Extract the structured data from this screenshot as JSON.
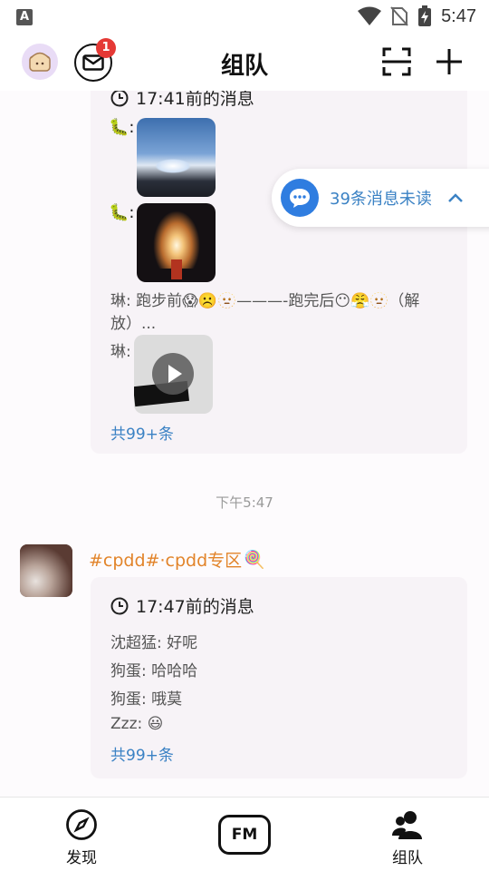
{
  "status_bar": {
    "time": "5:47",
    "app_badge": "A"
  },
  "header": {
    "title": "组队",
    "mail_badge": "1"
  },
  "card1": {
    "head_time": "17:41前的消息",
    "msg_text": "琳: 跑步前😱☹️🫥———-跑完后😶😤🫥（解放）...",
    "video_sender": "琳:",
    "more": "共99+条"
  },
  "unread": {
    "text": "39条消息未读"
  },
  "time_separator": "下午5:47",
  "group": {
    "name": "#cpdd#·cpdd专区",
    "emoji": "🍭"
  },
  "card2": {
    "head_time": "17:47前的消息",
    "messages": [
      "沈超猛: 好呢",
      "狗蛋: 哈哈哈",
      "狗蛋: 哦莫",
      "Zzz: 😃"
    ],
    "more": "共99+条"
  },
  "bottom_nav": {
    "discover": "发现",
    "fm": "FM",
    "team": "组队"
  },
  "colors": {
    "accent_blue": "#3b82c4",
    "group_orange": "#e2842a",
    "badge_red": "#e53935"
  }
}
